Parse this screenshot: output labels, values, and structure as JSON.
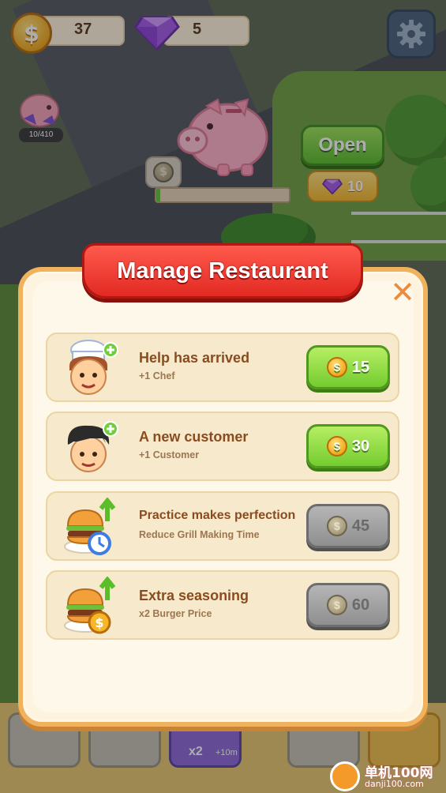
{
  "hud": {
    "coins": "37",
    "gems": "5",
    "coin_symbol": "$"
  },
  "piggy_bank": {
    "mini_count": "10/410",
    "open_label": "Open",
    "open_price": "10",
    "progress": 0.03
  },
  "modal": {
    "title": "Manage Restaurant",
    "close_symbol": "✕",
    "upgrades": [
      {
        "title": "Help has arrived",
        "subtitle": "+1 Chef",
        "price": "15",
        "enabled": true,
        "icon": "chef-avatar-icon"
      },
      {
        "title": "A new customer",
        "subtitle": "+1 Customer",
        "price": "30",
        "enabled": true,
        "icon": "customer-avatar-icon"
      },
      {
        "title": "Practice makes perfection",
        "subtitle": "Reduce Grill Making Time",
        "price": "45",
        "enabled": false,
        "icon": "burger-timer-icon"
      },
      {
        "title": "Extra seasoning",
        "subtitle": "x2 Burger Price",
        "price": "60",
        "enabled": false,
        "icon": "burger-coin-icon"
      }
    ]
  },
  "bottom_bar": {
    "boost_label": "x2",
    "boost_time": "+10m"
  },
  "watermark": {
    "line1": "单机100网",
    "line2": "danji100.com"
  },
  "colors": {
    "accent_green": "#74cc2f",
    "ribbon_red": "#e22a23",
    "panel_border": "#f0b25d",
    "title_brown": "#8a4c1f"
  }
}
